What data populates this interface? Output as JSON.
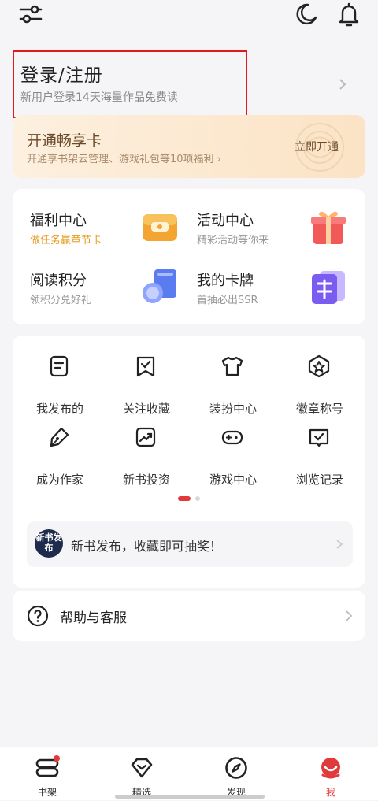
{
  "header": {
    "filter_icon": "sliders-icon",
    "theme_icon": "moon-icon",
    "notify_icon": "bell-icon"
  },
  "login": {
    "title": "登录/注册",
    "subtitle": "新用户登录14天海量作品免费读"
  },
  "vip": {
    "title": "开通畅享卡",
    "subtitle": "开通享书架云管理、游戏礼包等10项福利 ›",
    "button": "立即开通"
  },
  "welfare": [
    {
      "title": "福利中心",
      "subtitle": "做任务赢章节卡",
      "icon": "wallet-icon"
    },
    {
      "title": "活动中心",
      "subtitle": "精彩活动等你来",
      "icon": "gift-icon"
    },
    {
      "title": "阅读积分",
      "subtitle": "领积分兑好礼",
      "icon": "coin-book-icon"
    },
    {
      "title": "我的卡牌",
      "subtitle": "首抽必出SSR",
      "icon": "card-icon"
    }
  ],
  "grid": [
    {
      "label": "我发布的",
      "icon": "document-icon"
    },
    {
      "label": "关注收藏",
      "icon": "bookmark-check-icon"
    },
    {
      "label": "装扮中心",
      "icon": "tshirt-icon"
    },
    {
      "label": "徽章称号",
      "icon": "badge-star-icon"
    },
    {
      "label": "成为作家",
      "icon": "pen-icon"
    },
    {
      "label": "新书投资",
      "icon": "chart-up-icon"
    },
    {
      "label": "游戏中心",
      "icon": "gamepad-icon"
    },
    {
      "label": "浏览记录",
      "icon": "history-book-icon"
    }
  ],
  "notice": {
    "logo_text": "新书发布",
    "text": "新书发布，收藏即可抽奖！"
  },
  "help": {
    "text": "帮助与客服"
  },
  "tabs": [
    {
      "label": "书架",
      "icon": "bookshelf-icon"
    },
    {
      "label": "精选",
      "icon": "diamond-icon"
    },
    {
      "label": "发现",
      "icon": "compass-icon"
    },
    {
      "label": "我",
      "icon": "profile-icon"
    }
  ],
  "colors": {
    "accent": "#e13a3a",
    "login_outline": "#e11b1b",
    "vip_text": "#6b4a2a",
    "welfare_highlight": "#e69a1a"
  }
}
